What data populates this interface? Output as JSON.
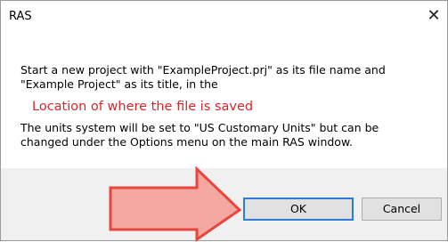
{
  "window": {
    "title": "RAS",
    "close_glyph": "✕"
  },
  "message": {
    "line1": "Start a new project with \"ExampleProject.prj\" as its file name and",
    "line2": "\"Example Project\" as its title, in the",
    "location": "Location of where the file is saved",
    "line3": "The units system will be set to \"US Customary Units\" but can be",
    "line4": "changed under the Options menu on the main RAS window."
  },
  "buttons": {
    "ok_label": "OK",
    "cancel_label": "Cancel"
  },
  "annotation": {
    "arrow_color": "#e8453c",
    "arrow_fill": "#f4a6a1"
  },
  "colors": {
    "location_text": "#d9262b",
    "focus_border": "#2b7bd8"
  }
}
